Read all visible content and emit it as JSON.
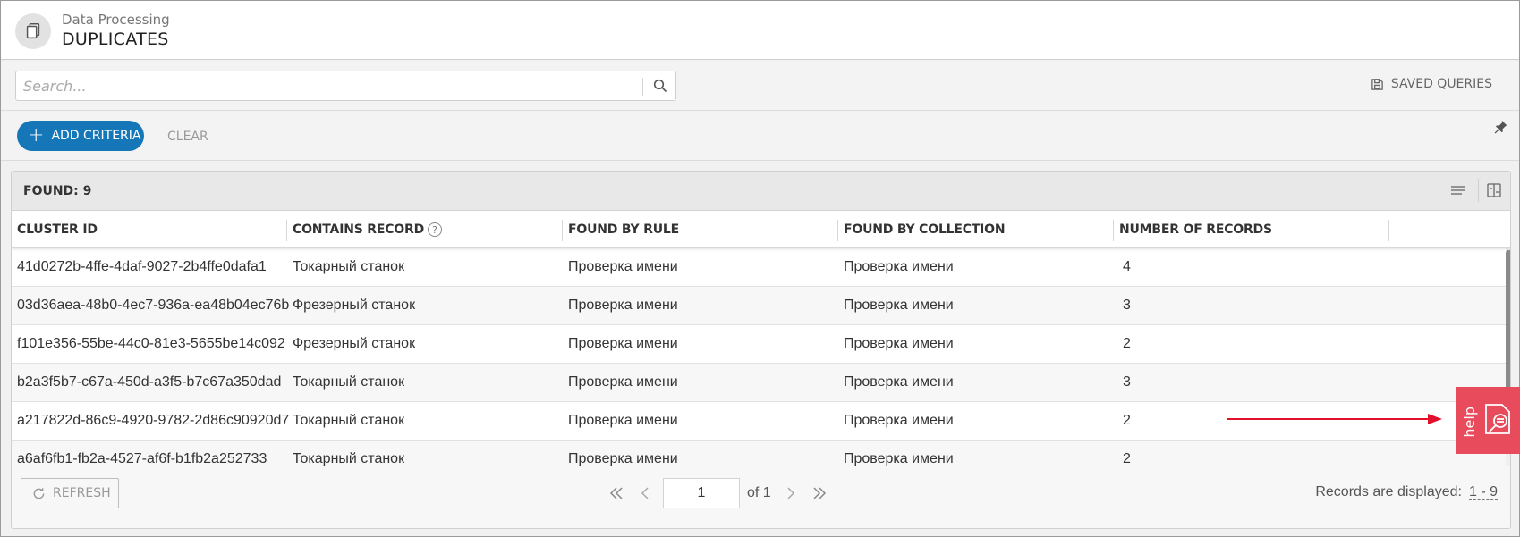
{
  "header": {
    "subtitle": "Data Processing",
    "title": "DUPLICATES"
  },
  "search": {
    "placeholder": "Search...",
    "value": "",
    "saved_queries_label": "SAVED QUERIES"
  },
  "criteria": {
    "add_label": "ADD CRITERIA",
    "clear_label": "CLEAR"
  },
  "grid": {
    "found_label": "FOUND: 9",
    "columns": [
      {
        "label": "CLUSTER ID"
      },
      {
        "label": "CONTAINS RECORD",
        "help": "?"
      },
      {
        "label": "FOUND BY RULE"
      },
      {
        "label": "FOUND BY COLLECTION"
      },
      {
        "label": "NUMBER OF RECORDS"
      }
    ],
    "rows": [
      [
        "41d0272b-4ffe-4daf-9027-2b4ffe0dafa1",
        "Токарный станок",
        "Проверка имени",
        "Проверка имени",
        "4"
      ],
      [
        "03d36aea-48b0-4ec7-936a-ea48b04ec76b",
        "Фрезерный станок",
        "Проверка имени",
        "Проверка имени",
        "3"
      ],
      [
        "f101e356-55be-44c0-81e3-5655be14c092",
        "Фрезерный станок",
        "Проверка имени",
        "Проверка имени",
        "2"
      ],
      [
        "b2a3f5b7-c67a-450d-a3f5-b7c67a350dad",
        "Токарный станок",
        "Проверка имени",
        "Проверка имени",
        "3"
      ],
      [
        "a217822d-86c9-4920-9782-2d86c90920d7",
        "Токарный станок",
        "Проверка имени",
        "Проверка имени",
        "2"
      ],
      [
        "a6af6fb1-fb2a-4527-af6f-b1fb2a252733",
        "Токарный станок",
        "Проверка имени",
        "Проверка имени",
        "2"
      ]
    ]
  },
  "footer": {
    "refresh_label": "REFRESH",
    "page_value": "1",
    "of_label": "of 1",
    "records_label": "Records are displayed:",
    "records_range": "1 - 9"
  },
  "help_widget": {
    "label": "help",
    "color": "#e84b5c"
  },
  "colors": {
    "accent": "#1577b8",
    "annotation_arrow": "#e2102a"
  },
  "icons": {
    "app": "documents-icon",
    "search": "search-icon",
    "saved": "save-icon",
    "pin": "pin-icon",
    "refresh": "refresh-icon"
  }
}
